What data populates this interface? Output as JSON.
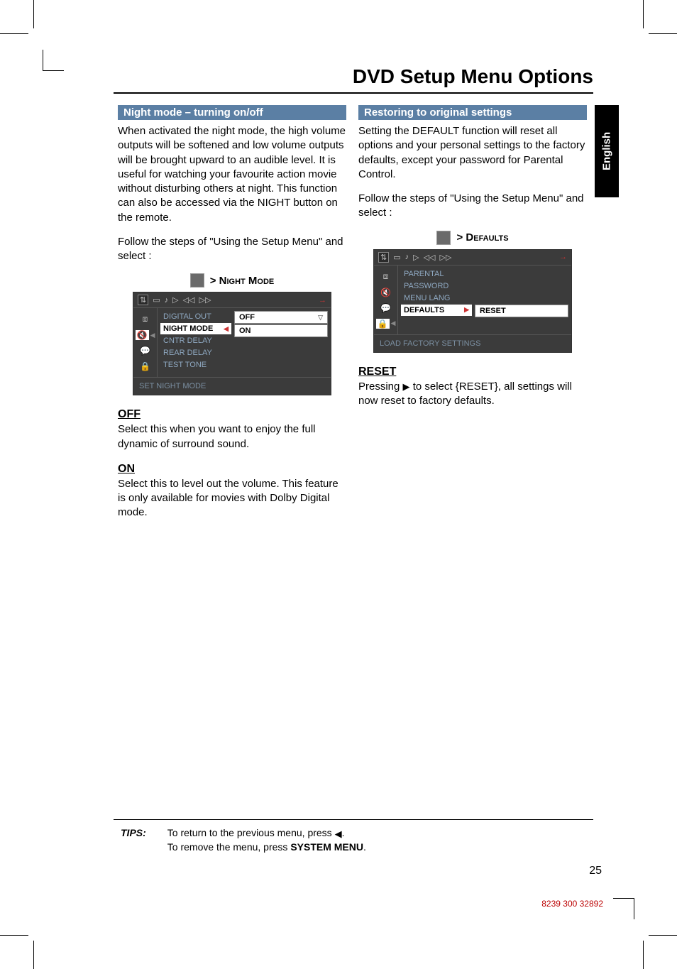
{
  "title": "DVD Setup Menu Options",
  "side_tab": "English",
  "left": {
    "section_bar": "Night mode – turning on/off",
    "intro": "When activated the night mode, the high volume outputs will be softened and low volume outputs will be brought upward to an audible level.  It is useful for watching your favourite action movie without disturbing others at night. This function can also be accessed via the NIGHT button on the remote.",
    "follow": "Follow the steps of \"Using the Setup Menu\" and select :",
    "breadcrumb": "> Night Mode",
    "osd": {
      "top_icons": [
        "⇅",
        "▭",
        "♪",
        "▷",
        "◁◁",
        "▷▷"
      ],
      "left_icons": [
        "⧈",
        "🔇",
        "💬",
        "🔒"
      ],
      "list": [
        "DIGITAL OUT",
        "NIGHT MODE",
        "CNTR DELAY",
        "REAR DELAY",
        "TEST TONE"
      ],
      "opt_off": "OFF",
      "opt_on": "ON",
      "footer": "SET NIGHT MODE"
    },
    "off_head": "OFF",
    "off_body": "Select this when you want to enjoy the full dynamic of surround sound.",
    "on_head": "ON",
    "on_body": "Select this to level out the volume. This feature is only available for movies with Dolby Digital mode."
  },
  "right": {
    "section_bar": "Restoring to original settings",
    "intro": "Setting the DEFAULT function will reset all options and your personal settings to the factory defaults, except your password for Parental Control.",
    "follow": "Follow the steps of \"Using the Setup Menu\" and select :",
    "breadcrumb": "> Defaults",
    "osd": {
      "top_icons": [
        "⇅",
        "▭",
        "♪",
        "▷",
        "◁◁",
        "▷▷"
      ],
      "left_icons": [
        "⧈",
        "🔇",
        "💬",
        "🔒"
      ],
      "list": [
        "PARENTAL",
        "PASSWORD",
        "MENU LANG",
        "DEFAULTS"
      ],
      "opt": "RESET",
      "footer": "LOAD FACTORY SETTINGS"
    },
    "reset_head": "RESET",
    "reset_body_1": "Pressing ",
    "reset_body_2": " to select {RESET},  all settings will now reset to factory defaults."
  },
  "tips": {
    "label": "TIPS:",
    "line1_a": "To return to the previous menu, press ",
    "line1_b": ".",
    "line2_a": "To remove the menu, press ",
    "line2_bold": "SYSTEM MENU",
    "line2_b": "."
  },
  "page_num": "25",
  "doc_code": "8239 300 32892"
}
